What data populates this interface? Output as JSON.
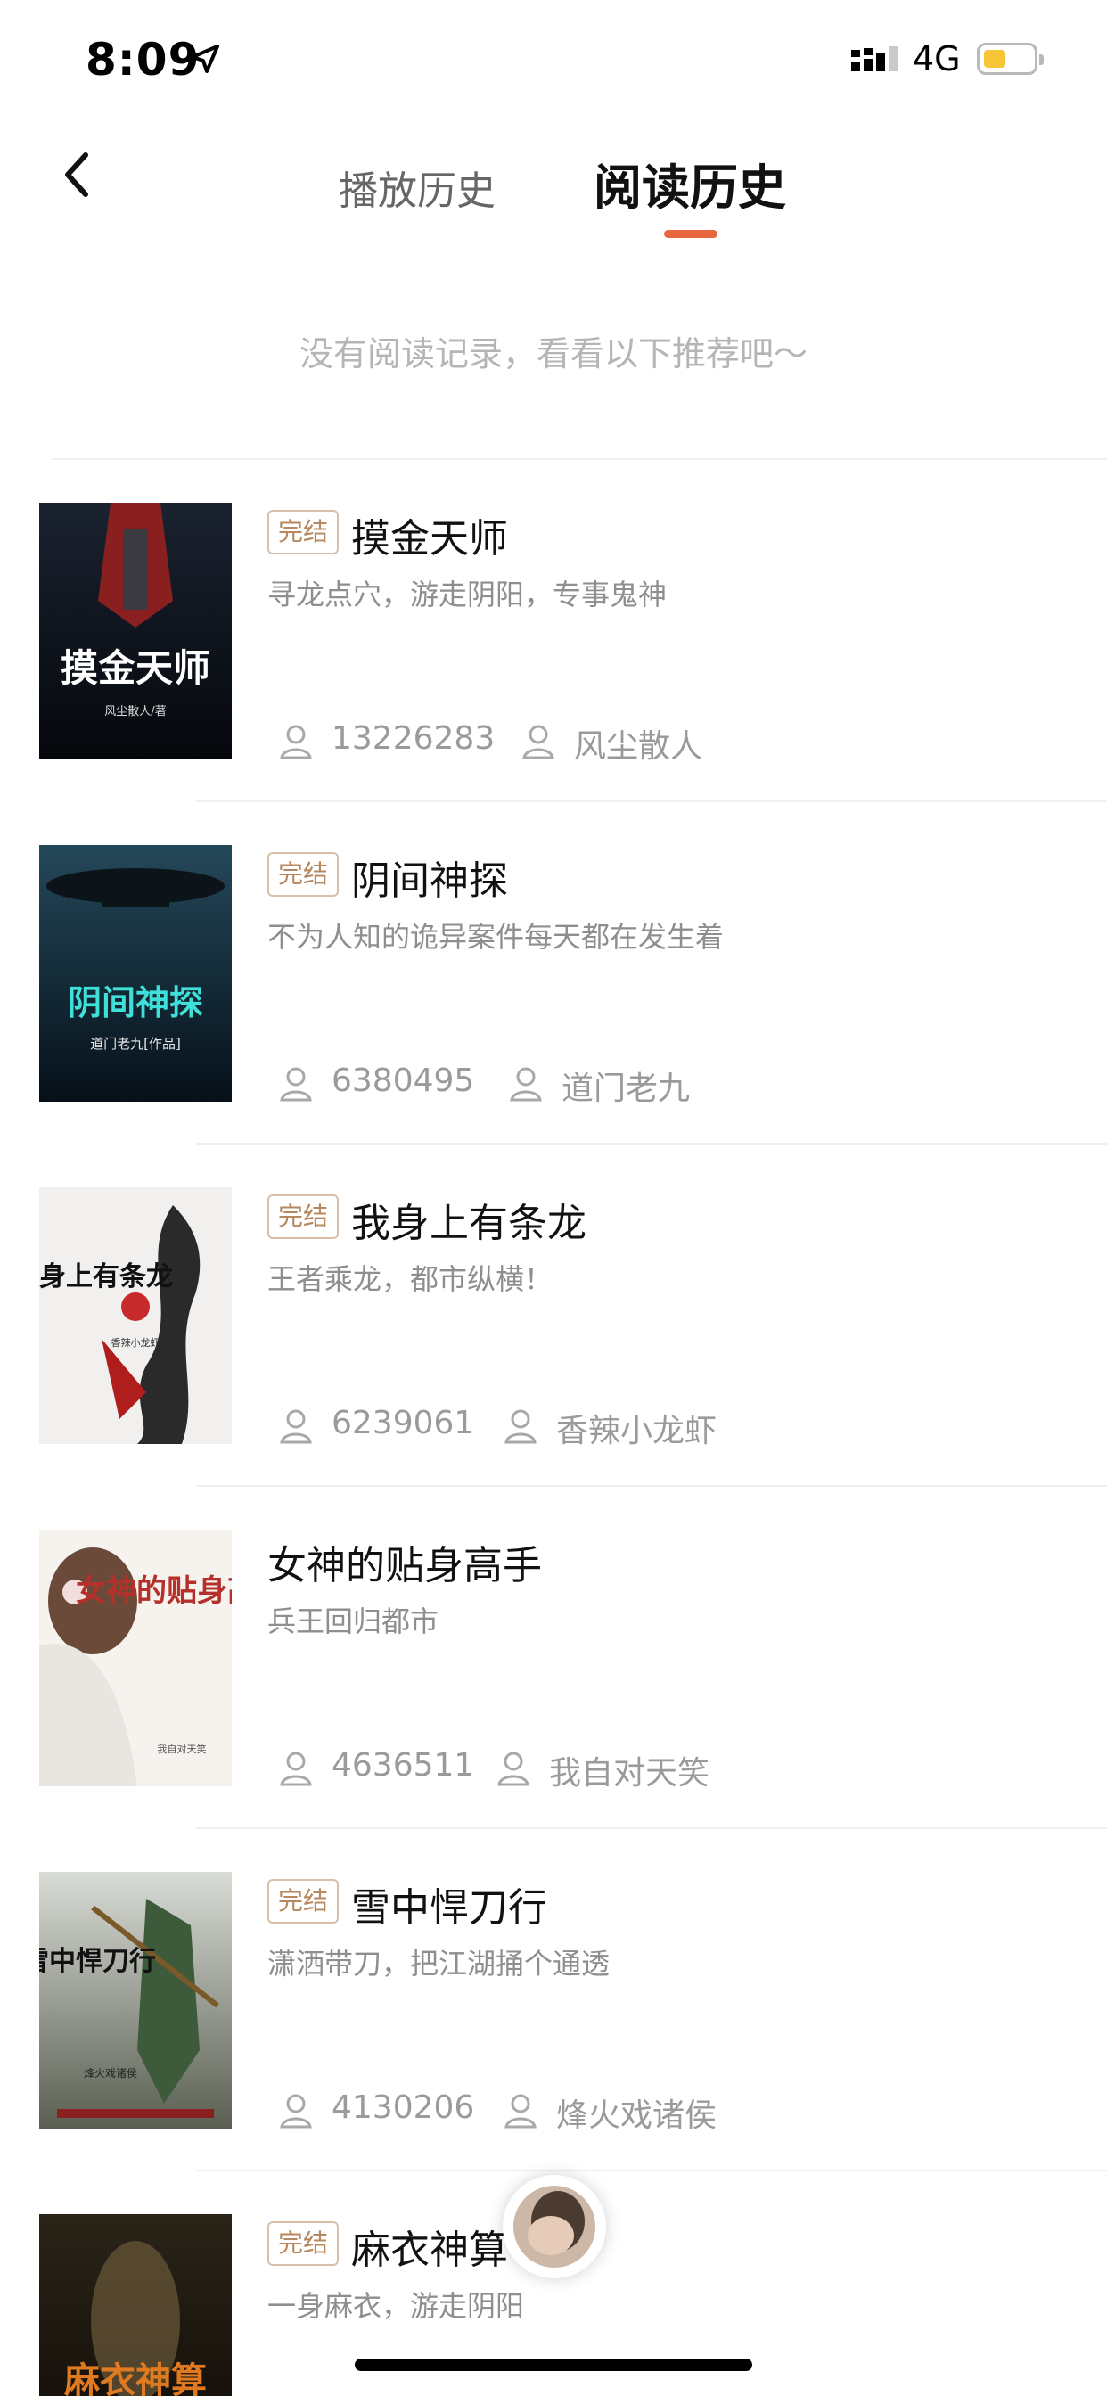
{
  "status_bar": {
    "time": "8:09",
    "network": "4G",
    "battery_level": 0.3
  },
  "header": {
    "tabs": [
      {
        "label": "播放历史",
        "selected": false
      },
      {
        "label": "阅读历史",
        "selected": true
      }
    ],
    "indicator_color": "#e8663d"
  },
  "empty_message": "没有阅读记录，看看以下推荐吧～",
  "books": [
    {
      "badge": "完结",
      "title": "摸金天师",
      "description": "寻龙点穴，游走阴阳，专事鬼神",
      "readers": "13226283",
      "author": "风尘散人",
      "cover_text": "摸金天师",
      "cover_subtext": "风尘散人/著"
    },
    {
      "badge": "完结",
      "title": "阴间神探",
      "description": "不为人知的诡异案件每天都在发生着",
      "readers": "6380495",
      "author": "道门老九",
      "cover_text": "阴间神探",
      "cover_subtext": "道门老九[作品]"
    },
    {
      "badge": "完结",
      "title": "我身上有条龙",
      "description": "王者乘龙，都市纵横！",
      "readers": "6239061",
      "author": "香辣小龙虾",
      "cover_text": "我身上有条龙",
      "cover_subtext": "香辣小龙虾"
    },
    {
      "badge": "",
      "title": "女神的贴身高手",
      "description": "兵王回归都市",
      "readers": "4636511",
      "author": "我自对天笑",
      "cover_text": "女神的贴身高手",
      "cover_subtext": "我自对天笑"
    },
    {
      "badge": "完结",
      "title": "雪中悍刀行",
      "description": "潇洒带刀，把江湖捅个通透",
      "readers": "4130206",
      "author": "烽火戏诸侯",
      "cover_text": "雪中悍刀行",
      "cover_subtext": "烽火戏诸侯"
    },
    {
      "badge": "完结",
      "title": "麻衣神算",
      "description": "一身麻衣，游走阴阳",
      "readers": "",
      "author": "",
      "cover_text": "麻衣神算",
      "cover_subtext": ""
    }
  ]
}
